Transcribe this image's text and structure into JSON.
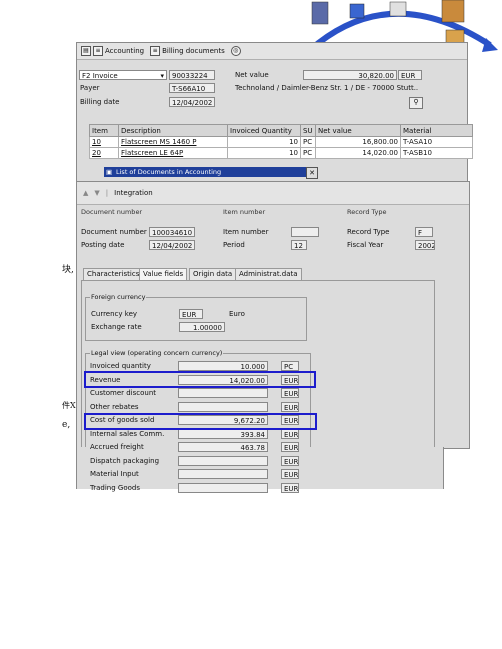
{
  "doc": {
    "chinese_left_1": "块,",
    "chinese_left_2": "件X",
    "chinese_left_3": "e,"
  },
  "invoice_window": {
    "toolbar": {
      "accounting_label": "Accounting",
      "billing_docs_label": "Billing documents"
    },
    "invoice_type": "F2 Invoice",
    "invoice_number": "90033224",
    "net_value_label": "Net value",
    "net_value": "30,820.00",
    "currency": "EUR",
    "payer_label": "Payer",
    "payer": "T-S66A10",
    "payer_name": "Technoland / Daimler-Benz Str. 1 / DE - 70000 Stutt..",
    "billing_date_label": "Billing date",
    "billing_date": "12/04/2002",
    "columns": [
      "Item",
      "Description",
      "Invoiced Quantity",
      "SU",
      "Net value",
      "Material"
    ],
    "rows": [
      [
        "10",
        "Flatscreen MS 1460 P",
        "10",
        "PC",
        "16,800.00",
        "T-ASA10"
      ],
      [
        "20",
        "Flatscreen LE 64P",
        "10",
        "PC",
        "14,020.00",
        "T-ASB10"
      ]
    ]
  },
  "doc_list_popup": {
    "title": "List of Documents in Accounting"
  },
  "accounting_window": {
    "toolbar_label": "Integration",
    "doc_number_label": "Document number",
    "doc_number": "100034610",
    "item_number_label": "Item number",
    "record_type_label": "Record Type",
    "record_type": "F",
    "posting_date_label": "Posting date",
    "posting_date": "12/04/2002",
    "period_label": "Period",
    "period": "12",
    "fiscal_year_label": "Fiscal Year",
    "fiscal_year": "2002",
    "tabs": [
      "Characteristics",
      "Value fields",
      "Origin data",
      "Administrat.data"
    ],
    "foreign_currency": {
      "title": "Foreign currency",
      "currency_key_label": "Currency key",
      "currency_key": "EUR",
      "currency_name": "Euro",
      "exchange_rate_label": "Exchange rate",
      "exchange_rate": "1.00000"
    },
    "legal_view": {
      "title": "Legal view (operating concern currency)",
      "rows": [
        {
          "label": "Invoiced quantity",
          "value": "10.000",
          "unit": "PC"
        },
        {
          "label": "Revenue",
          "value": "14,020.00",
          "unit": "EUR"
        },
        {
          "label": "Customer discount",
          "value": "",
          "unit": "EUR"
        },
        {
          "label": "Other rebates",
          "value": "",
          "unit": "EUR"
        },
        {
          "label": "Cost of goods sold",
          "value": "9,672.20",
          "unit": "EUR"
        },
        {
          "label": "Internal sales Comm.",
          "value": "393.84",
          "unit": "EUR"
        },
        {
          "label": "Accrued freight",
          "value": "463.78",
          "unit": "EUR"
        },
        {
          "label": "Dispatch packaging",
          "value": "",
          "unit": "EUR"
        },
        {
          "label": "Material Input",
          "value": "",
          "unit": "EUR"
        },
        {
          "label": "Trading Goods",
          "value": "",
          "unit": "EUR"
        }
      ]
    }
  },
  "colors": {
    "highlight": "#1c1ccc",
    "titlebar": "#1f3f9a"
  }
}
